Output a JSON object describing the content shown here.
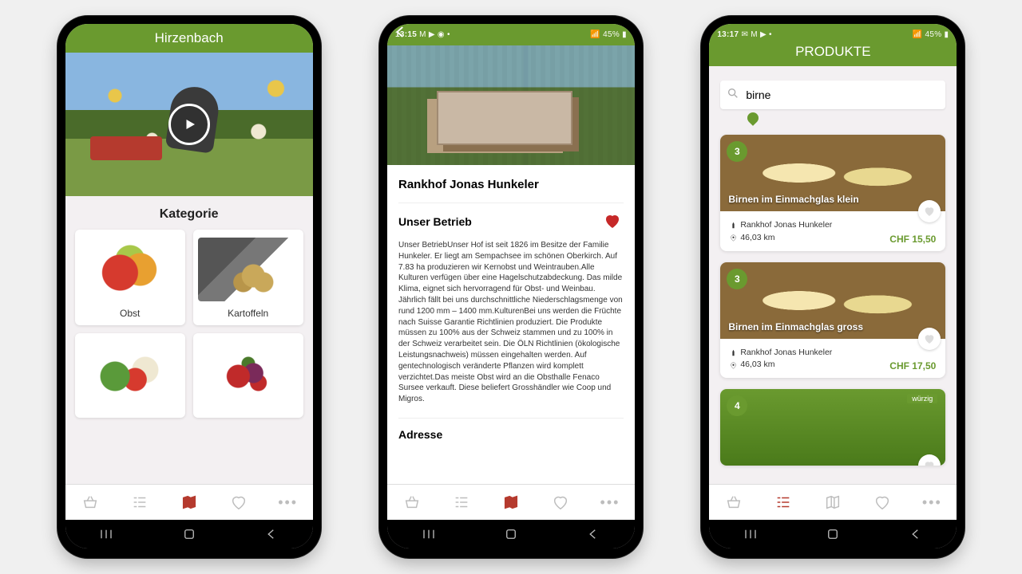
{
  "colors": {
    "brand": "#6a9a2f",
    "accent": "#b53a2e",
    "heart": "#c62828"
  },
  "phone1": {
    "header_title": "Hirzenbach",
    "section_title": "Kategorie",
    "categories": [
      {
        "label": "Obst",
        "img_class": "cat-obst"
      },
      {
        "label": "Kartoffeln",
        "img_class": "cat-kartoffel"
      },
      {
        "label": "",
        "img_class": "cat-gemuese"
      },
      {
        "label": "",
        "img_class": "cat-beeren"
      }
    ],
    "nav_active_index": 2
  },
  "phone2": {
    "status_time": "13:15",
    "status_left": "M ▶ ◉ •",
    "status_right": "📶 45% ▮",
    "farm_title": "Rankhof Jonas Hunkeler",
    "section_title": "Unser Betrieb",
    "favorited": true,
    "description": "Unser BetriebUnser Hof ist seit 1826 im Besitze der Familie Hunkeler. Er liegt am Sempachsee im schönen Oberkirch. Auf 7.83 ha produzieren wir Kernobst und Weintrauben.Alle Kulturen verfügen über eine Hagelschutzabdeckung. Das milde Klima, eignet sich hervorragend für Obst- und Weinbau. Jährlich fällt bei uns durchschnittliche Niederschlagsmenge von rund 1200 mm – 1400 mm.KulturenBei uns werden die Früchte nach Suisse Garantie Richtlinien produziert. Die Produkte müssen zu 100% aus der Schweiz stammen und zu 100% in der Schweiz verarbeitet sein. Die ÖLN Richtlinien (ökologische Leistungsnachweis) müssen eingehalten werden. Auf gentechnologisch veränderte Pflanzen wird komplett verzichtet.Das meiste Obst wird an die Obsthalle Fenaco Sursee verkauft. Diese beliefert Grosshändler wie Coop und Migros.",
    "address_title": "Adresse",
    "nav_active_index": 2
  },
  "phone3": {
    "status_time": "13:17",
    "status_left": "✉ M ▶ •",
    "status_right": "📶 45% ▮",
    "header_title": "PRODUKTE",
    "search_placeholder": "",
    "search_value": "birne",
    "products": [
      {
        "badge": "3",
        "name": "Birnen im Einmachglas klein",
        "farm": "Rankhof Jonas Hunkeler",
        "distance": "46,03 km",
        "price": "CHF 15,50",
        "img_class": "jars"
      },
      {
        "badge": "3",
        "name": "Birnen im Einmachglas gross",
        "farm": "Rankhof Jonas Hunkeler",
        "distance": "46,03 km",
        "price": "CHF 17,50",
        "img_class": "jars"
      },
      {
        "badge": "4",
        "name": "",
        "farm": "",
        "distance": "",
        "price": "",
        "img_class": "green",
        "tag": "würzig"
      }
    ],
    "nav_active_index": 1
  },
  "bottom_nav_icons": [
    "basket-icon",
    "list-icon",
    "map-icon",
    "heart-icon",
    "more-icon"
  ]
}
